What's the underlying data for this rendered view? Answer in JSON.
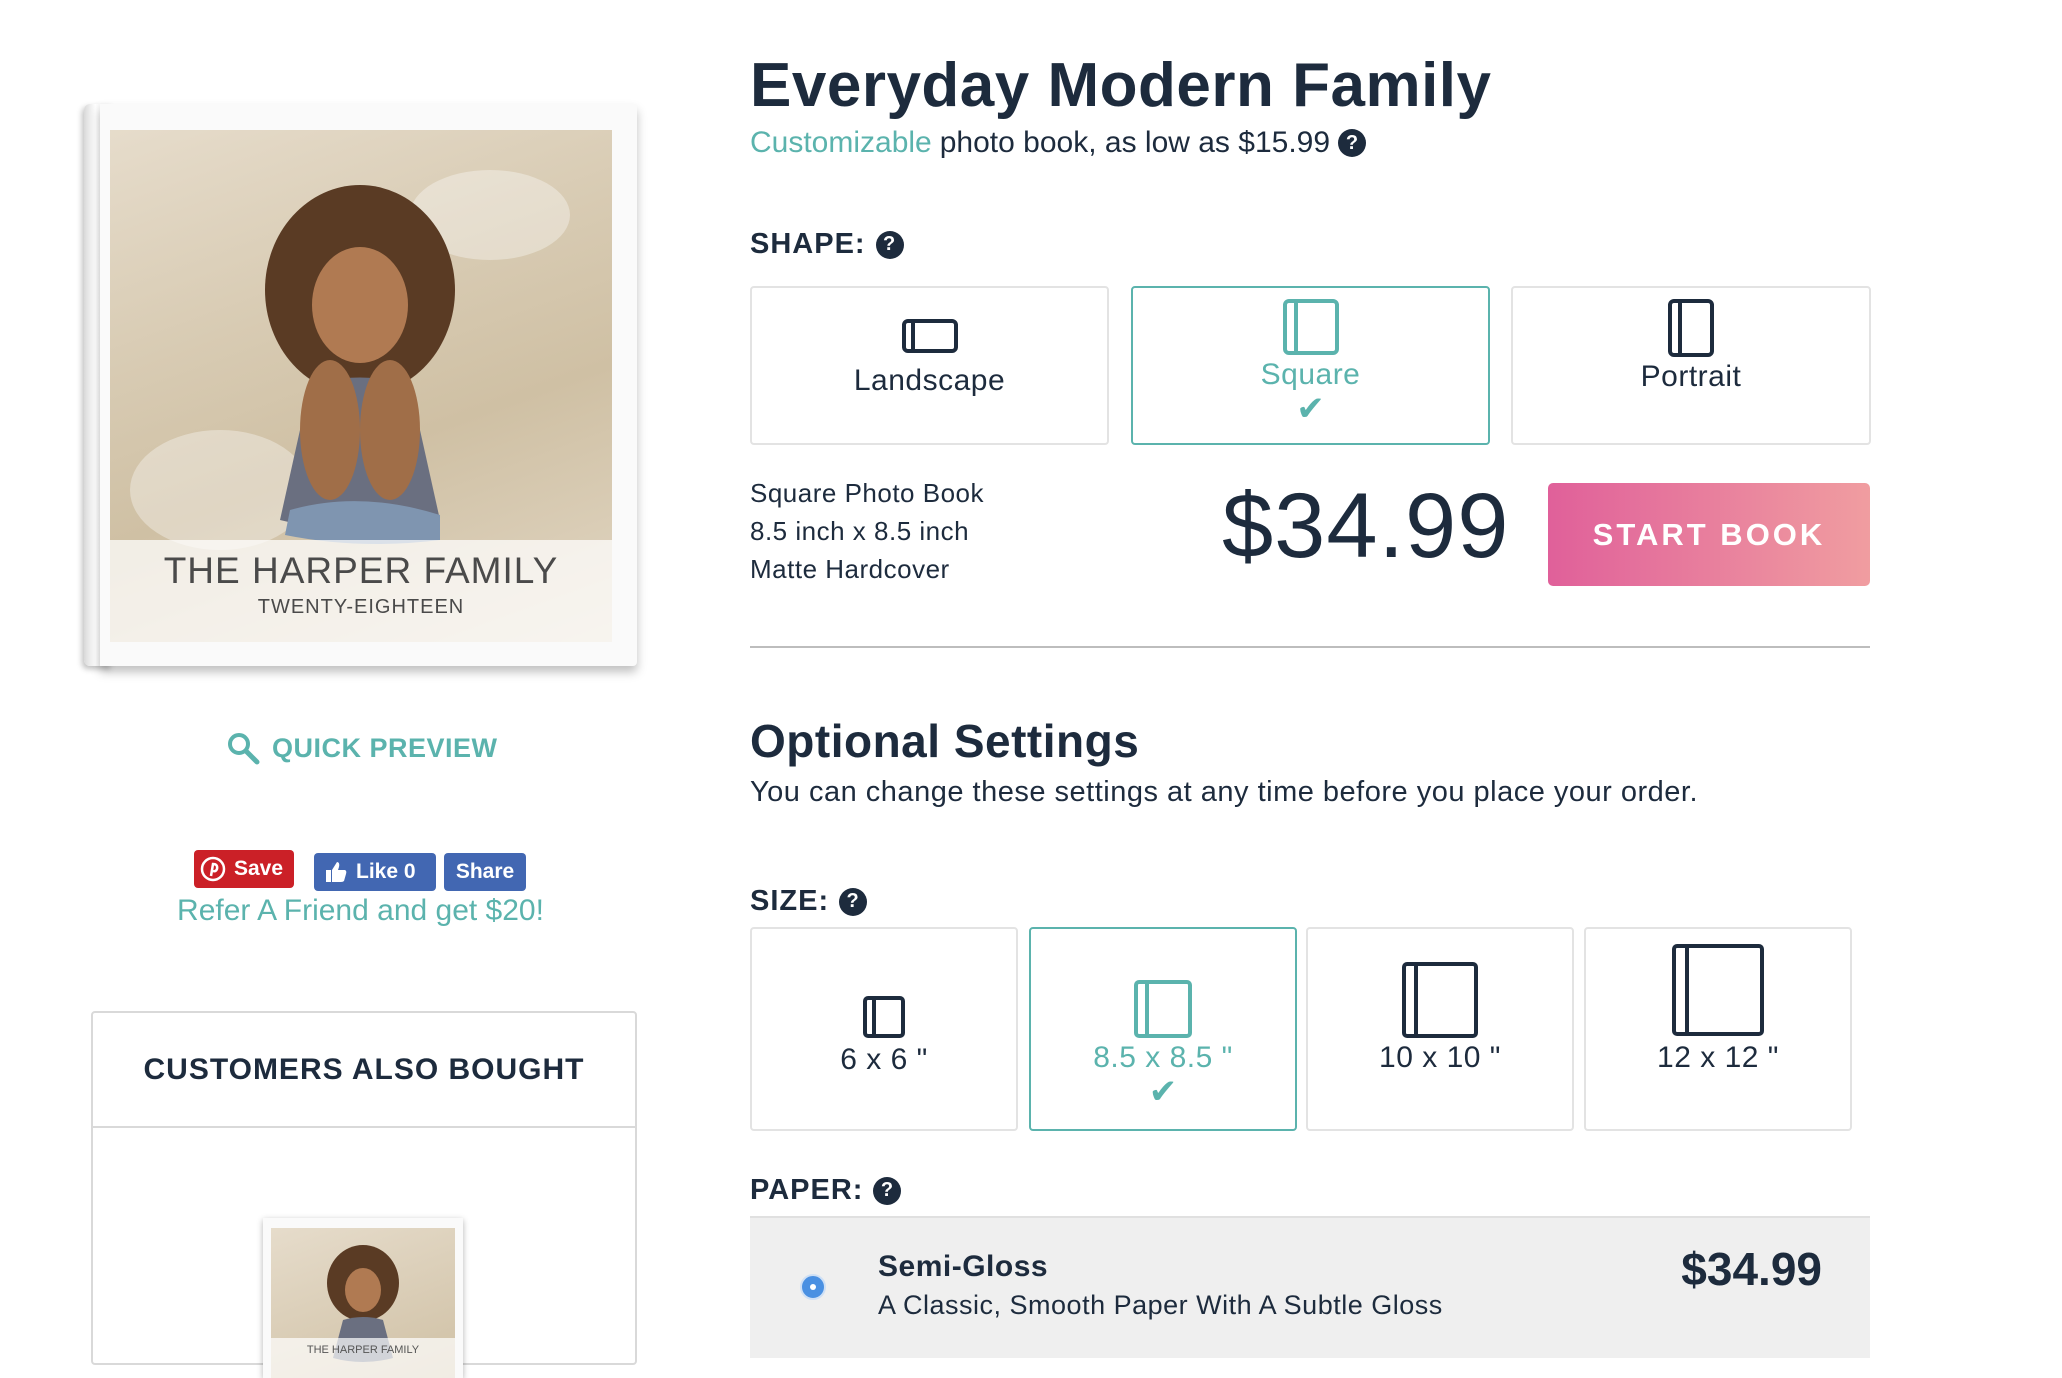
{
  "product": {
    "title": "Everyday Modern Family",
    "subtitle_accent": "Customizable",
    "subtitle_rest": "photo book, as low as $15.99"
  },
  "cover": {
    "title": "THE HARPER FAMILY",
    "subtitle": "TWENTY-EIGHTEEN"
  },
  "quick_preview": "QUICK PREVIEW",
  "social": {
    "pin_label": "Save",
    "like_label": "Like 0",
    "share_label": "Share"
  },
  "refer": "Refer A Friend and get $20!",
  "customers_also_bought": {
    "title": "CUSTOMERS ALSO BOUGHT",
    "mini_cover_title": "THE HARPER FAMILY"
  },
  "shape": {
    "label": "SHAPE:",
    "options": [
      {
        "label": "Landscape",
        "selected": false
      },
      {
        "label": "Square",
        "selected": true
      },
      {
        "label": "Portrait",
        "selected": false
      }
    ]
  },
  "spec": {
    "line1": "Square Photo Book",
    "line2": "8.5 inch x 8.5 inch",
    "line3": "Matte Hardcover"
  },
  "price": "$34.99",
  "start_button": "START BOOK",
  "optional": {
    "title": "Optional Settings",
    "description": "You can change these settings at any time before you place your order."
  },
  "size": {
    "label": "SIZE:",
    "options": [
      {
        "label": "6 x 6 \"",
        "selected": false
      },
      {
        "label": "8.5 x 8.5 \"",
        "selected": true
      },
      {
        "label": "10 x 10 \"",
        "selected": false
      },
      {
        "label": "12 x 12 \"",
        "selected": false
      }
    ]
  },
  "paper": {
    "label": "PAPER:",
    "options": [
      {
        "name": "Semi-Gloss",
        "description": "A Classic, Smooth Paper With A Subtle Gloss",
        "price": "$34.99",
        "selected": true
      }
    ]
  },
  "colors": {
    "accent": "#5bb3ad",
    "navy": "#1d2b3d",
    "pinterest": "#cb2027",
    "facebook": "#4267b2",
    "cta_start": "#e0609a",
    "cta_end": "#f09da0"
  }
}
